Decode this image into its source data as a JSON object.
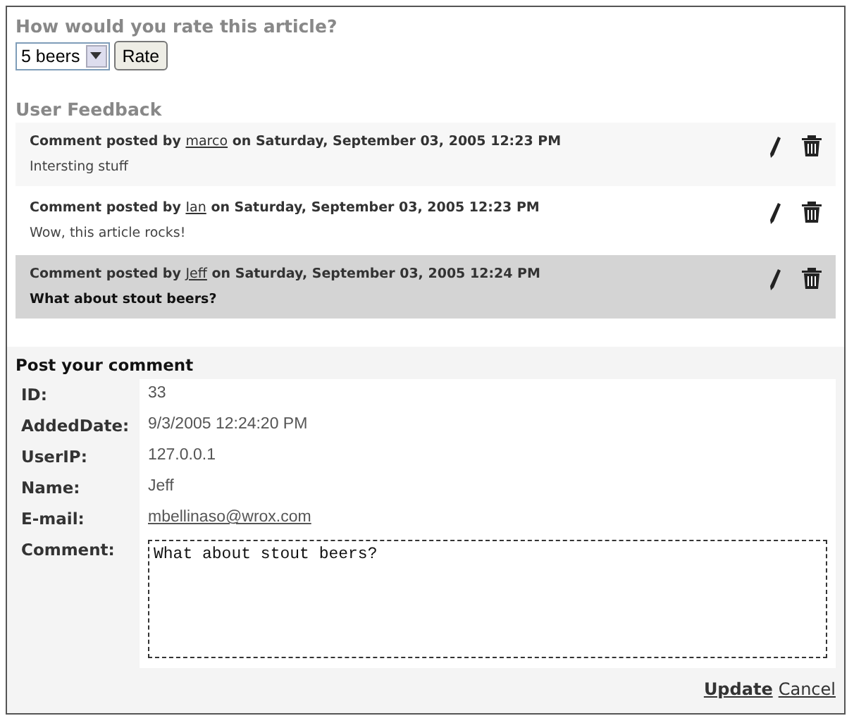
{
  "rating": {
    "question": "How would you rate this article?",
    "select_value": "5 beers",
    "button": "Rate"
  },
  "feedback": {
    "title": "User Feedback",
    "comments": [
      {
        "prefix": "Comment posted by",
        "author": "marco",
        "date_text": "on Saturday, September 03, 2005 12:23 PM",
        "body": "Intersting stuff",
        "selected": false
      },
      {
        "prefix": "Comment posted by",
        "author": "Ian",
        "date_text": "on Saturday, September 03, 2005 12:23 PM",
        "body": "Wow, this article rocks!",
        "selected": false
      },
      {
        "prefix": "Comment posted by",
        "author": "Jeff",
        "date_text": "on Saturday, September 03, 2005 12:24 PM",
        "body": "What about stout beers?",
        "selected": true
      }
    ]
  },
  "post": {
    "title": "Post your comment",
    "fields": [
      {
        "label": "ID:",
        "value": "33",
        "kind": "text"
      },
      {
        "label": "AddedDate:",
        "value": "9/3/2005 12:24:20 PM",
        "kind": "text"
      },
      {
        "label": "UserIP:",
        "value": "127.0.0.1",
        "kind": "text"
      },
      {
        "label": "Name:",
        "value": "Jeff",
        "kind": "text"
      },
      {
        "label": "E-mail:",
        "value": "mbellinaso@wrox.com",
        "kind": "link"
      },
      {
        "label": "Comment:",
        "value": "What about stout beers?",
        "kind": "textarea"
      }
    ],
    "actions": [
      {
        "label": "Update",
        "primary": true
      },
      {
        "label": "Cancel",
        "primary": false
      }
    ]
  }
}
